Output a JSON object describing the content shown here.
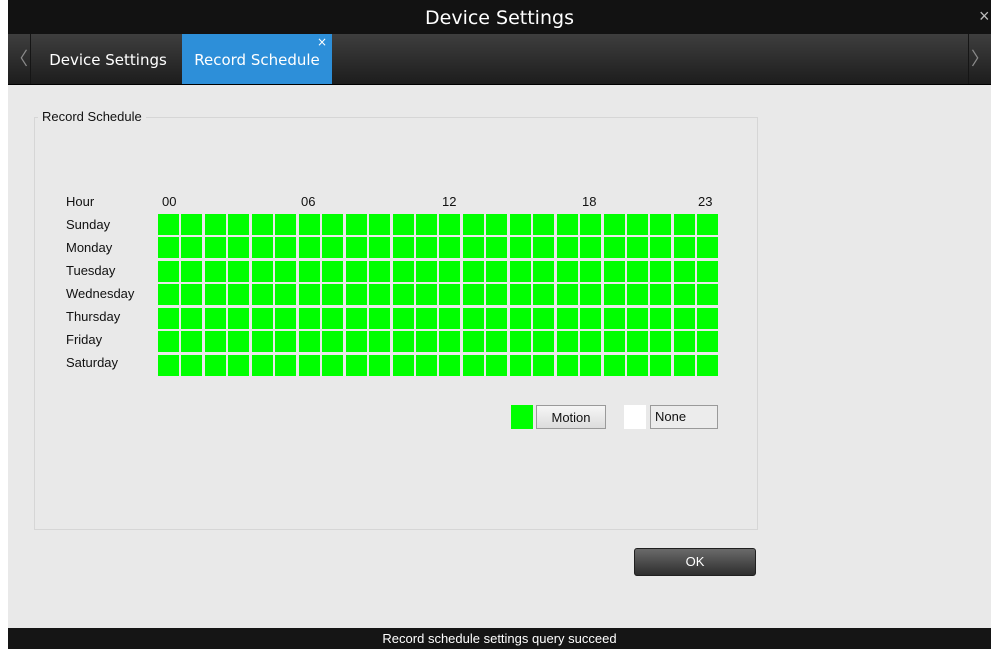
{
  "window": {
    "title": "Device Settings",
    "close_glyph": "×"
  },
  "tabs": {
    "prev_glyph": "〈",
    "next_glyph": "〉",
    "items": [
      {
        "label": "Device Settings"
      },
      {
        "label": "Record Schedule",
        "close_glyph": "×"
      }
    ]
  },
  "schedule": {
    "group_label": "Record Schedule",
    "hour_label": "Hour",
    "hour_ticks": [
      "00",
      "06",
      "12",
      "18",
      "23"
    ],
    "days": [
      "Sunday",
      "Monday",
      "Tuesday",
      "Wednesday",
      "Thursday",
      "Friday",
      "Saturday"
    ],
    "hours_per_day": 24,
    "cell_state": "Motion"
  },
  "legend": {
    "motion_label": "Motion",
    "motion_color": "#00ff00",
    "none_label": "None",
    "none_color": "#ffffff"
  },
  "ok_label": "OK",
  "status": "Record schedule settings query succeed",
  "colors": {
    "accent_tab": "#2d8fd9",
    "motion": "#00ff00"
  },
  "icons": [
    "close-icon",
    "chevron-left-icon",
    "chevron-right-icon",
    "tab-close-icon"
  ]
}
